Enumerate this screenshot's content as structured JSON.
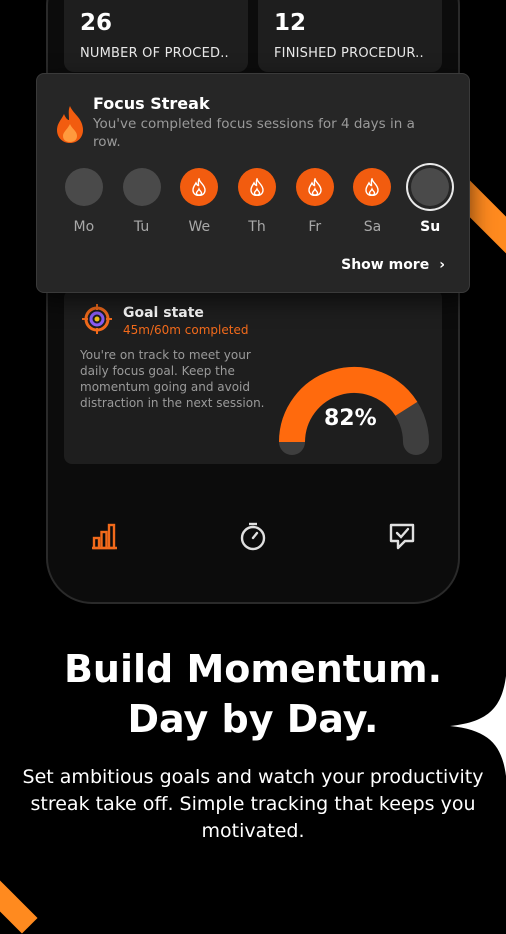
{
  "stats": [
    {
      "value": "26",
      "label": "NUMBER OF PROCED.."
    },
    {
      "value": "12",
      "label": "FINISHED PROCEDUR.."
    }
  ],
  "streak": {
    "title": "Focus Streak",
    "subtitle": "You've completed focus sessions for 4 days in a row.",
    "days": [
      {
        "label": "Mo",
        "state": "inactive"
      },
      {
        "label": "Tu",
        "state": "inactive"
      },
      {
        "label": "We",
        "state": "active"
      },
      {
        "label": "Th",
        "state": "active"
      },
      {
        "label": "Fr",
        "state": "active"
      },
      {
        "label": "Sa",
        "state": "active"
      },
      {
        "label": "Su",
        "state": "today"
      }
    ],
    "show_more": "Show more",
    "accent": "#f25c0f"
  },
  "goal": {
    "title": "Goal state",
    "progress_text": "45m/60m completed",
    "description": "You're on track to meet your daily focus goal. Keep the momentum going and avoid distraction in the next session.",
    "percent_label": "82%",
    "percent": 82
  },
  "nav": {
    "items": [
      {
        "icon": "bar-chart-icon",
        "active": true
      },
      {
        "icon": "stopwatch-icon",
        "active": false
      },
      {
        "icon": "checklist-icon",
        "active": false
      }
    ]
  },
  "marketing": {
    "headline_line1": "Build Momentum.",
    "headline_line2": "Day by Day.",
    "subcopy": "Set ambitious goals and watch your productivity streak take off. Simple tracking that keeps you motivated."
  }
}
